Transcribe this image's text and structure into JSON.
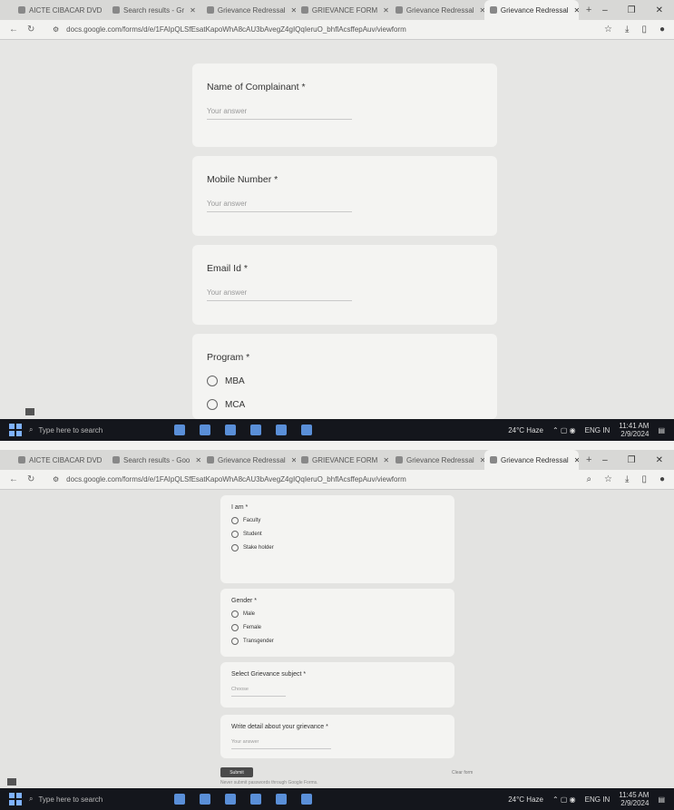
{
  "shot1": {
    "tabs": [
      {
        "label": "AICTE CIBACAR DVD",
        "active": false
      },
      {
        "label": "Search results - Gr",
        "active": false
      },
      {
        "label": "Grievance Redressal",
        "active": false
      },
      {
        "label": "GRIEVANCE FORM",
        "active": false
      },
      {
        "label": "Grievance Redressal",
        "active": false
      },
      {
        "label": "Grievance Redressal",
        "active": true
      }
    ],
    "url": "docs.google.com/forms/d/e/1FAIpQLSfEsatKapoWhA8cAU3bAvegZ4gIQqIeruO_bhflAcsffepAuv/viewform",
    "cards": {
      "complainant": {
        "label": "Name of Complainant *",
        "placeholder": "Your answer"
      },
      "mobile": {
        "label": "Mobile Number *",
        "placeholder": "Your answer"
      },
      "email": {
        "label": "Email Id *",
        "placeholder": "Your answer"
      },
      "program": {
        "label": "Program *",
        "options": [
          "MBA",
          "MCA"
        ]
      }
    },
    "taskbar": {
      "search": "Type here to search",
      "weather": "24°C Haze",
      "lang": "ENG IN",
      "time": "11:41 AM",
      "date": "2/9/2024"
    }
  },
  "shot2": {
    "tabs": [
      {
        "label": "AICTE CIBACAR DVD",
        "active": false
      },
      {
        "label": "Search results - Goo",
        "active": false
      },
      {
        "label": "Grievance Redressal",
        "active": false
      },
      {
        "label": "GRIEVANCE FORM",
        "active": false
      },
      {
        "label": "Grievance Redressal",
        "active": false
      },
      {
        "label": "Grievance Redressal",
        "active": true
      }
    ],
    "url": "docs.google.com/forms/d/e/1FAIpQLSfEsatKapoWhA8cAU3bAvegZ4gIQqIeruO_bhflAcsffepAuv/viewform",
    "cards": {
      "iam": {
        "label": "I am *",
        "options": [
          "Faculty",
          "Student",
          "Stake holder"
        ]
      },
      "gender": {
        "label": "Gender *",
        "options": [
          "Male",
          "Female",
          "Transgender"
        ]
      },
      "subject": {
        "label": "Select Grievance subject *",
        "placeholder": "Choose"
      },
      "details": {
        "label": "Write detail about your grievance *",
        "placeholder": "Your answer"
      }
    },
    "submit": "Submit",
    "clear": "Clear form",
    "never": "Never submit passwords through Google Forms.",
    "taskbar": {
      "search": "Type here to search",
      "weather": "24°C Haze",
      "lang": "ENG IN",
      "time": "11:45 AM",
      "date": "2/9/2024"
    }
  }
}
